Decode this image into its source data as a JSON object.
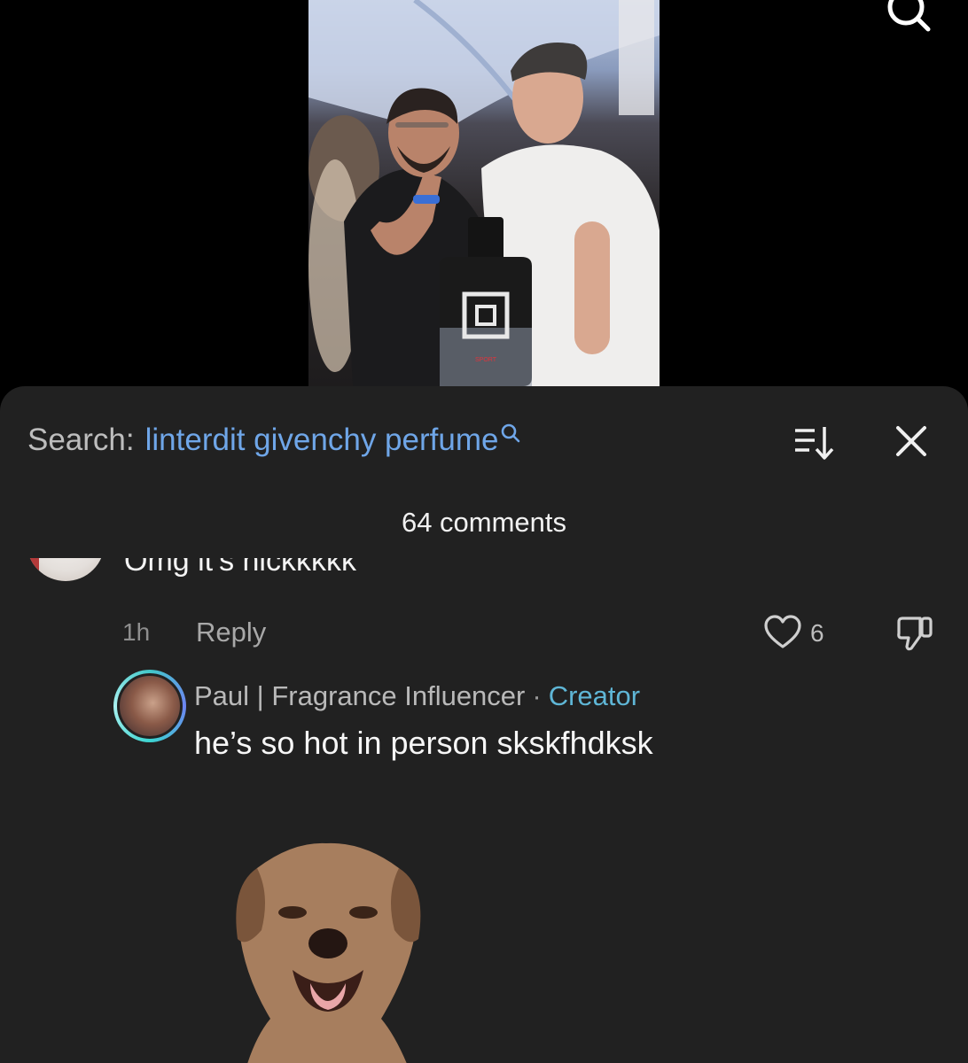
{
  "video": {
    "product_label": "SPORT"
  },
  "sheet": {
    "search_prefix": "Search:",
    "search_query": "linterdit givenchy perfume",
    "comment_count": "64 comments"
  },
  "comments": [
    {
      "text": "Omg it’s nickkkkk",
      "time": "1h",
      "reply_label": "Reply",
      "likes": "6",
      "replies": [
        {
          "author": "Paul | Fragrance Influencer",
          "separator": "·",
          "badge": "Creator",
          "text": "he’s so hot in person skskfhdksk"
        }
      ]
    }
  ],
  "icons": {
    "top": "search-icon",
    "search_inline": "search-icon",
    "sort": "sort-icon",
    "close": "close-icon",
    "like": "heart-icon",
    "dislike": "thumbs-down-icon"
  },
  "colors": {
    "sheet_bg": "#212121",
    "query_blue": "#6fa6e8",
    "creator_badge": "#5fb6d6"
  }
}
